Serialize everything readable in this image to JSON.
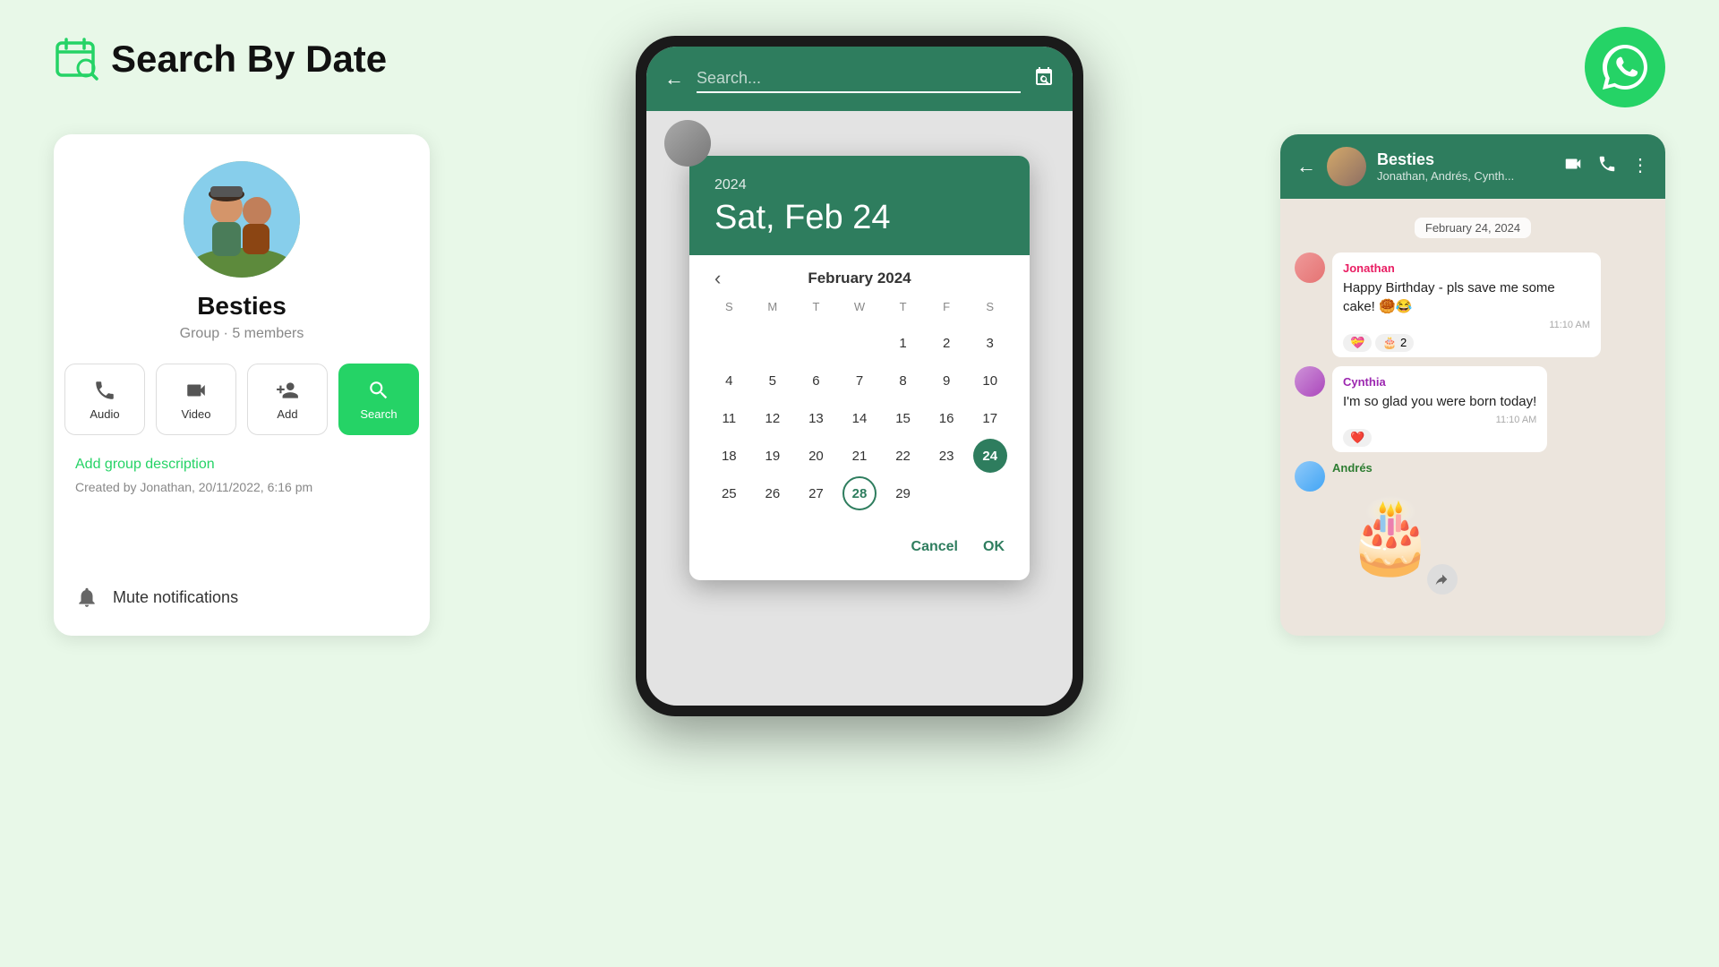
{
  "header": {
    "title_green": "Search",
    "title_rest": " By Date"
  },
  "left_card": {
    "group_name": "Besties",
    "group_meta": "Group · 5 members",
    "buttons": [
      {
        "label": "Audio",
        "icon": "phone"
      },
      {
        "label": "Video",
        "icon": "video"
      },
      {
        "label": "Add",
        "icon": "add-person"
      },
      {
        "label": "Search",
        "icon": "search",
        "active": true
      }
    ],
    "add_description": "Add group description",
    "created_by": "Created by Jonathan, 20/11/2022, 6:16 pm",
    "mute_label": "Mute notifications"
  },
  "phone": {
    "search_placeholder": "Search...",
    "calendar": {
      "year": "2024",
      "selected_display": "Sat, Feb 24",
      "month_year": "February 2024",
      "day_headers": [
        "S",
        "M",
        "T",
        "W",
        "T",
        "F",
        "S"
      ],
      "weeks": [
        [
          "",
          "",
          "",
          "",
          "1",
          "2",
          "3"
        ],
        [
          "4",
          "5",
          "6",
          "7",
          "8",
          "9",
          "10"
        ],
        [
          "11",
          "12",
          "13",
          "14",
          "15",
          "16",
          "17"
        ],
        [
          "18",
          "19",
          "20",
          "21",
          "22",
          "23",
          "24"
        ],
        [
          "25",
          "26",
          "27",
          "28",
          "29",
          "",
          ""
        ]
      ],
      "selected_day": "24",
      "circled_day": "28",
      "cancel_label": "Cancel",
      "ok_label": "OK"
    }
  },
  "right_card": {
    "chat_name": "Besties",
    "chat_members": "Jonathan, Andrés, Cynth...",
    "date_divider": "February 24, 2024",
    "messages": [
      {
        "sender": "Jonathan",
        "sender_class": "jonathan",
        "avatar_class": "jonathan-av",
        "text": "Happy Birthday - pls save me some cake! 🥮😂",
        "time": "11:10 AM",
        "reactions": [
          "💝",
          "🎂",
          "2"
        ]
      },
      {
        "sender": "Cynthia",
        "sender_class": "cynthia",
        "avatar_class": "cynthia-av",
        "text": "I'm so glad you were born today!",
        "time": "11:10 AM",
        "reactions": [
          "❤️"
        ]
      },
      {
        "sender": "Andrés",
        "sender_class": "andres",
        "avatar_class": "andres-av",
        "text": "",
        "sticker": "🎂",
        "time": ""
      }
    ]
  }
}
